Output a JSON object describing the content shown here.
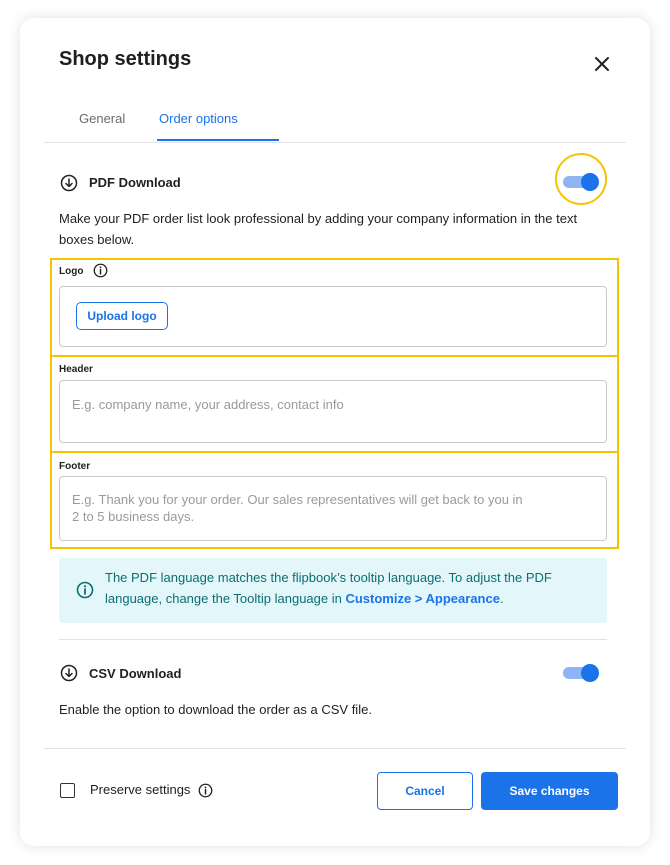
{
  "dialog": {
    "title": "Shop settings"
  },
  "tabs": [
    {
      "label": "General",
      "active": false
    },
    {
      "label": "Order options",
      "active": true
    }
  ],
  "pdf": {
    "title": "PDF Download",
    "enabled": true,
    "description": "Make your PDF order list look professional by adding your company information in the text boxes below.",
    "logo": {
      "label": "Logo",
      "button_label": "Upload logo"
    },
    "header": {
      "label": "Header",
      "placeholder": "E.g. company name, your address, contact info"
    },
    "footer": {
      "label": "Footer",
      "placeholder": "E.g. Thank you for your order. Our sales representatives will get back to you in 2 to 5 business days."
    }
  },
  "info": {
    "text": "The PDF language matches the flipbook’s tooltip language. To adjust the PDF language, change the Tooltip language in ",
    "link": "Customize > Appearance",
    "suffix": "."
  },
  "csv": {
    "title": "CSV Download",
    "enabled": true,
    "description": "Enable the option to download the order as a CSV file."
  },
  "footer": {
    "preserve_label": "Preserve settings",
    "preserve_checked": false,
    "cancel_label": "Cancel",
    "save_label": "Save changes"
  },
  "colors": {
    "accent": "#1a73e8",
    "highlight": "#f5c400",
    "info_bg": "#e3f7fa",
    "info_text": "#0a6e72"
  },
  "icons": [
    "close-icon",
    "download-circle-icon",
    "info-icon"
  ]
}
